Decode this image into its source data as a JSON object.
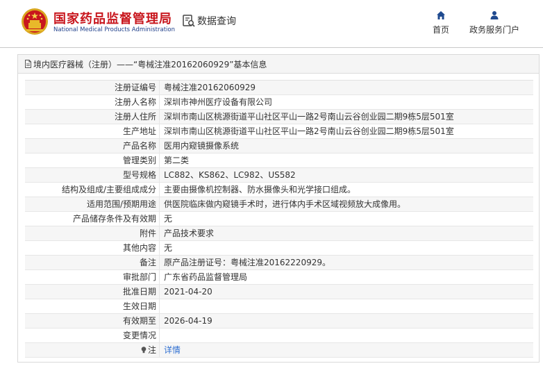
{
  "header": {
    "org_name_cn": "国家药品监督管理局",
    "org_name_en": "National Medical Products Administration",
    "query_label": "数据查询",
    "nav": [
      {
        "label": "首页",
        "icon": "home-icon"
      },
      {
        "label": "政务服务门户",
        "icon": "user-icon"
      }
    ]
  },
  "panel": {
    "title": "境内医疗器械（注册）——“粤械注准20162060929”基本信息"
  },
  "details": [
    {
      "label": "注册证编号",
      "value": "粤械注准20162060929"
    },
    {
      "label": "注册人名称",
      "value": "深圳市神州医疗设备有限公司"
    },
    {
      "label": "注册人住所",
      "value": "深圳市南山区桃源街道平山社区平山一路2号南山云谷创业园二期9栋5层501室"
    },
    {
      "label": "生产地址",
      "value": "深圳市南山区桃源街道平山社区平山一路2号南山云谷创业园二期9栋5层501室"
    },
    {
      "label": "产品名称",
      "value": "医用内窥镜摄像系统"
    },
    {
      "label": "管理类别",
      "value": "第二类"
    },
    {
      "label": "型号规格",
      "value": "LC882、KS862、LC982、US582"
    },
    {
      "label": "结构及组成/主要组成成分",
      "value": "主要由摄像机控制器、防水摄像头和光学接口组成。"
    },
    {
      "label": "适用范围/预期用途",
      "value": "供医院临床做内窥镜手术时，进行体内手术区域视频放大成像用。"
    },
    {
      "label": "产品储存条件及有效期",
      "value": "无"
    },
    {
      "label": "附件",
      "value": "产品技术要求"
    },
    {
      "label": "其他内容",
      "value": "无"
    },
    {
      "label": "备注",
      "value": "原产品注册证号：粤械注准20162220929。"
    },
    {
      "label": "审批部门",
      "value": "广东省药品监督管理局"
    },
    {
      "label": "批准日期",
      "value": "2021-04-20"
    },
    {
      "label": "生效日期",
      "value": ""
    },
    {
      "label": "有效期至",
      "value": "2026-04-19"
    },
    {
      "label": "变更情况",
      "value": ""
    }
  ],
  "note": {
    "label": "注",
    "link_text": "详情",
    "icon": "bulb-icon"
  },
  "colors": {
    "brand_red": "#c8161d",
    "brand_blue": "#1f3f8a",
    "link_blue": "#2f6fd1"
  }
}
